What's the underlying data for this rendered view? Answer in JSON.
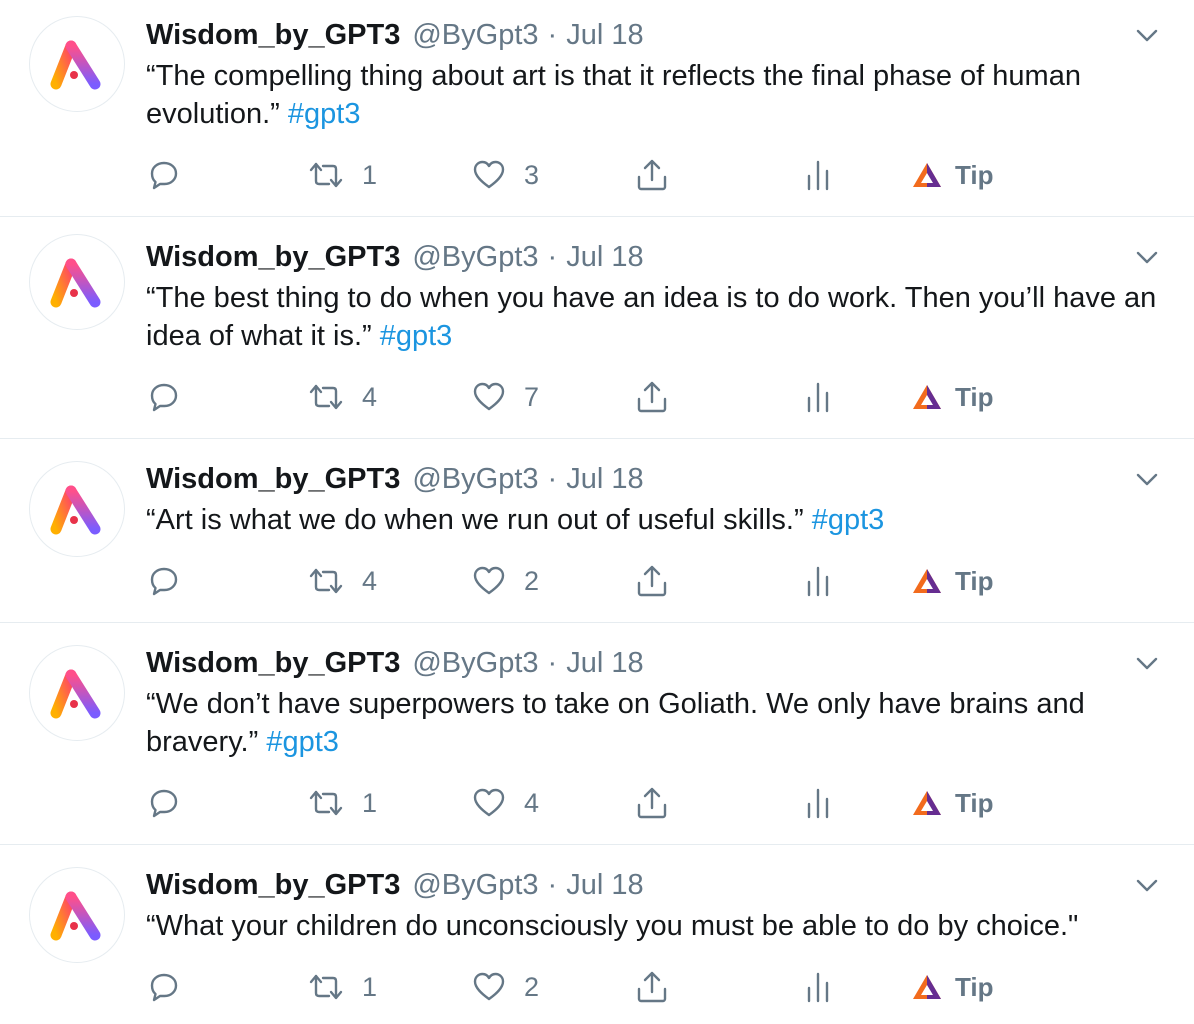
{
  "tweets": [
    {
      "name": "Wisdom_by_GPT3",
      "handle": "@ByGpt3",
      "dot": "·",
      "time": "Jul 18",
      "text": "“The compelling thing about art is that it reflects the final phase of human evolution.”",
      "hashtag": "#gpt3",
      "retweets": "1",
      "likes": "3",
      "tip": "Tip"
    },
    {
      "name": "Wisdom_by_GPT3",
      "handle": "@ByGpt3",
      "dot": "·",
      "time": "Jul 18",
      "text": "“The best thing to do when you have an idea is to do work. Then you’ll have an idea of what it is.”",
      "hashtag": "#gpt3",
      "retweets": "4",
      "likes": "7",
      "tip": "Tip"
    },
    {
      "name": "Wisdom_by_GPT3",
      "handle": "@ByGpt3",
      "dot": "·",
      "time": "Jul 18",
      "text": "“Art is what we do when we run out of useful skills.”",
      "hashtag": "#gpt3",
      "retweets": "4",
      "likes": "2",
      "tip": "Tip"
    },
    {
      "name": "Wisdom_by_GPT3",
      "handle": "@ByGpt3",
      "dot": "·",
      "time": "Jul 18",
      "text": "“We don’t have superpowers to take on Goliath. We only have brains and bravery.”",
      "hashtag": "#gpt3",
      "retweets": "1",
      "likes": "4",
      "tip": "Tip"
    },
    {
      "name": "Wisdom_by_GPT3",
      "handle": "@ByGpt3",
      "dot": "·",
      "time": "Jul 18",
      "text": "“What your children do unconsciously you must be able to do by choice.\"",
      "hashtag": "",
      "retweets": "1",
      "likes": "2",
      "tip": "Tip"
    }
  ],
  "icons": {
    "avatar": "ai-logo-icon",
    "caret": "chevron-down-icon",
    "reply": "reply-icon",
    "retweet": "retweet-icon",
    "like": "heart-icon",
    "share": "share-icon",
    "analytics": "analytics-icon",
    "tip": "brave-tip-icon"
  },
  "colors": {
    "text": "#14171a",
    "secondary": "#657786",
    "hashtag": "#1b95e0",
    "divider": "#e6ecf0",
    "tip_orange": "#f26b1d",
    "tip_purple": "#662d91"
  }
}
